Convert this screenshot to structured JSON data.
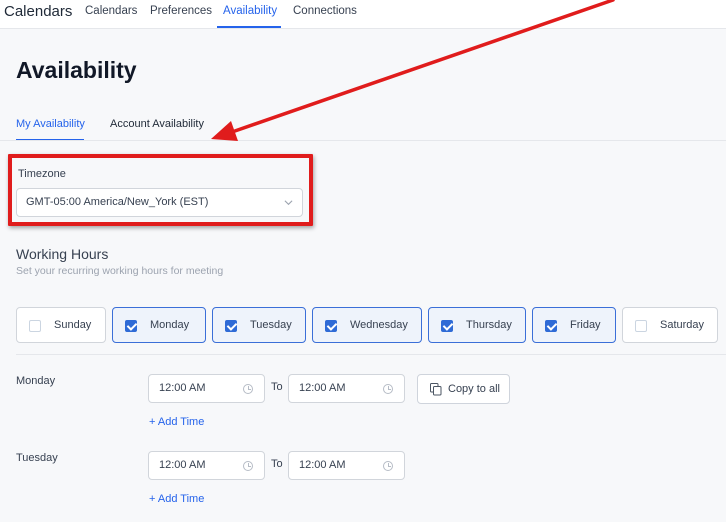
{
  "nav": {
    "brand": "Calendars",
    "items": [
      "Calendars",
      "Preferences",
      "Availability",
      "Connections"
    ]
  },
  "page": {
    "title": "Availability"
  },
  "tabs": [
    "My Availability",
    "Account Availability"
  ],
  "timezone": {
    "label": "Timezone",
    "value": "GMT-05:00 America/New_York (EST)"
  },
  "working_hours": {
    "title": "Working Hours",
    "subtitle": "Set your recurring working hours for meeting"
  },
  "days": [
    {
      "label": "Sunday",
      "checked": false
    },
    {
      "label": "Monday",
      "checked": true
    },
    {
      "label": "Tuesday",
      "checked": true
    },
    {
      "label": "Wednesday",
      "checked": true
    },
    {
      "label": "Thursday",
      "checked": true
    },
    {
      "label": "Friday",
      "checked": true
    },
    {
      "label": "Saturday",
      "checked": false
    }
  ],
  "schedule": [
    {
      "day": "Monday",
      "from": "12:00 AM",
      "to_label": "To",
      "to": "12:00 AM",
      "add_time": "+ Add Time"
    },
    {
      "day": "Tuesday",
      "from": "12:00 AM",
      "to_label": "To",
      "to": "12:00 AM",
      "add_time": "+ Add Time"
    }
  ],
  "copy_to_all": "Copy to all",
  "colors": {
    "accent": "#2563eb",
    "annotation": "#e01c1c"
  }
}
